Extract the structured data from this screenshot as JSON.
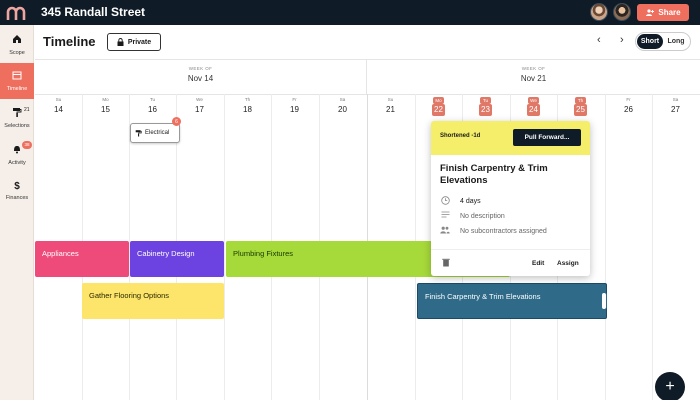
{
  "topbar": {
    "logo_icon": "m-arch-logo-icon",
    "title": "345 Randall Street",
    "share_label": "Share",
    "share_icon": "add-user-icon",
    "accent": "#ef6f5f",
    "bg": "#0f1b26"
  },
  "sidebar": {
    "items": [
      {
        "label": "Scope",
        "icon": "home-icon"
      },
      {
        "label": "Timeline",
        "icon": "calendar-icon",
        "active": true
      },
      {
        "label": "Selections",
        "icon": "paint-roller-icon",
        "count": "21"
      },
      {
        "label": "Activity",
        "icon": "bell-icon",
        "count": "38"
      },
      {
        "label": "Finances",
        "icon": "dollar-icon"
      }
    ]
  },
  "header": {
    "title": "Timeline",
    "private_label": "Private",
    "private_icon": "lock-icon",
    "view_short": "Short",
    "view_long": "Long",
    "selected_view": "Short"
  },
  "calendar": {
    "weeks": [
      {
        "caption": "WEEK OF",
        "date": "Nov 14"
      },
      {
        "caption": "WEEK OF",
        "date": "Nov 21"
      }
    ],
    "days": [
      {
        "name": "Su",
        "date": "14"
      },
      {
        "name": "Mo",
        "date": "15"
      },
      {
        "name": "Tu",
        "date": "16"
      },
      {
        "name": "We",
        "date": "17"
      },
      {
        "name": "Th",
        "date": "18"
      },
      {
        "name": "Fr",
        "date": "19"
      },
      {
        "name": "Sa",
        "date": "20"
      },
      {
        "name": "Su",
        "date": "21"
      },
      {
        "name": "Mo",
        "date": "22",
        "highlight": true
      },
      {
        "name": "Tu",
        "date": "23",
        "highlight": true
      },
      {
        "name": "We",
        "date": "24",
        "highlight": true
      },
      {
        "name": "Th",
        "date": "25",
        "highlight": true
      },
      {
        "name": "Fr",
        "date": "26"
      },
      {
        "name": "Sa",
        "date": "27"
      }
    ],
    "electrical": {
      "label": "Electrical",
      "badge": "6",
      "icon": "paint-roller-icon"
    },
    "tasks": {
      "appliances": "Appliances",
      "cabinetry": "Cabinetry Design",
      "plumbing": "Plumbing Fixtures",
      "flooring": "Gather Flooring Options",
      "carpentry": "Finish Carpentry & Trim Elevations"
    }
  },
  "popover": {
    "status": "Shortened -1d",
    "pull_forward": "Pull Forward...",
    "title": "Finish Carpentry & Trim Elevations",
    "duration": "4 days",
    "description": "No description",
    "subcontractors": "No subcontractors assigned",
    "edit_label": "Edit",
    "assign_label": "Assign"
  },
  "fab_icon": "plus-icon"
}
